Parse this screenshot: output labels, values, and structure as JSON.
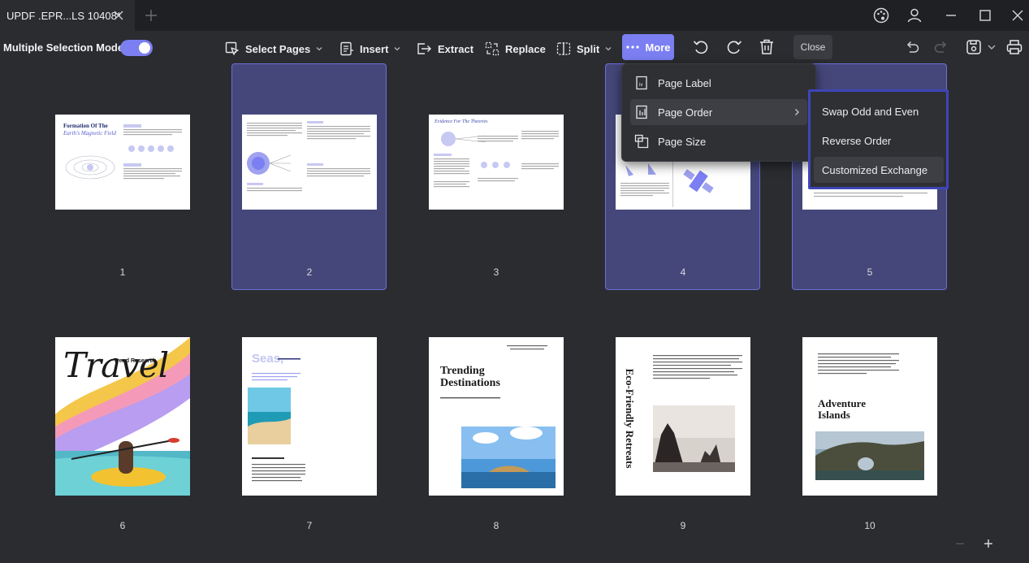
{
  "window": {
    "tab_title": "UPDF .EPR...LS 10408*"
  },
  "toolbar": {
    "multiple_selection_label": "Multiple Selection Mode",
    "multiple_selection_on": true,
    "select_pages": "Select Pages",
    "insert": "Insert",
    "extract": "Extract",
    "replace": "Replace",
    "split": "Split",
    "more": "More",
    "close": "Close"
  },
  "more_menu": {
    "items": [
      {
        "label": "Page Label",
        "icon": "page-label-icon"
      },
      {
        "label": "Page Order",
        "icon": "page-order-icon"
      },
      {
        "label": "Page Size",
        "icon": "page-size-icon"
      }
    ]
  },
  "page_order_submenu": {
    "items": [
      {
        "label": "Swap Odd and Even"
      },
      {
        "label": "Reverse Order"
      },
      {
        "label": "Customized Exchange"
      }
    ]
  },
  "pages": [
    {
      "number": "1",
      "selected": false,
      "title": "Formation Of The",
      "subtitle": "Earth's Magnetic Field"
    },
    {
      "number": "2",
      "selected": true
    },
    {
      "number": "3",
      "selected": false,
      "title": "Evidence For The Theories"
    },
    {
      "number": "4",
      "selected": true
    },
    {
      "number": "5",
      "selected": true
    },
    {
      "number": "6",
      "selected": false,
      "title": "Travel",
      "subtitle": "Trend Research"
    },
    {
      "number": "7",
      "selected": false,
      "title": "Seas,"
    },
    {
      "number": "8",
      "selected": false,
      "title": "Trending Destinations"
    },
    {
      "number": "9",
      "selected": false,
      "title": "Eco-Friendly Retreats"
    },
    {
      "number": "10",
      "selected": false,
      "title": "Adventure Islands"
    }
  ],
  "colors": {
    "accent": "#7b7ff2",
    "selection": "#45477a",
    "submenu_border": "#3f45b8"
  }
}
